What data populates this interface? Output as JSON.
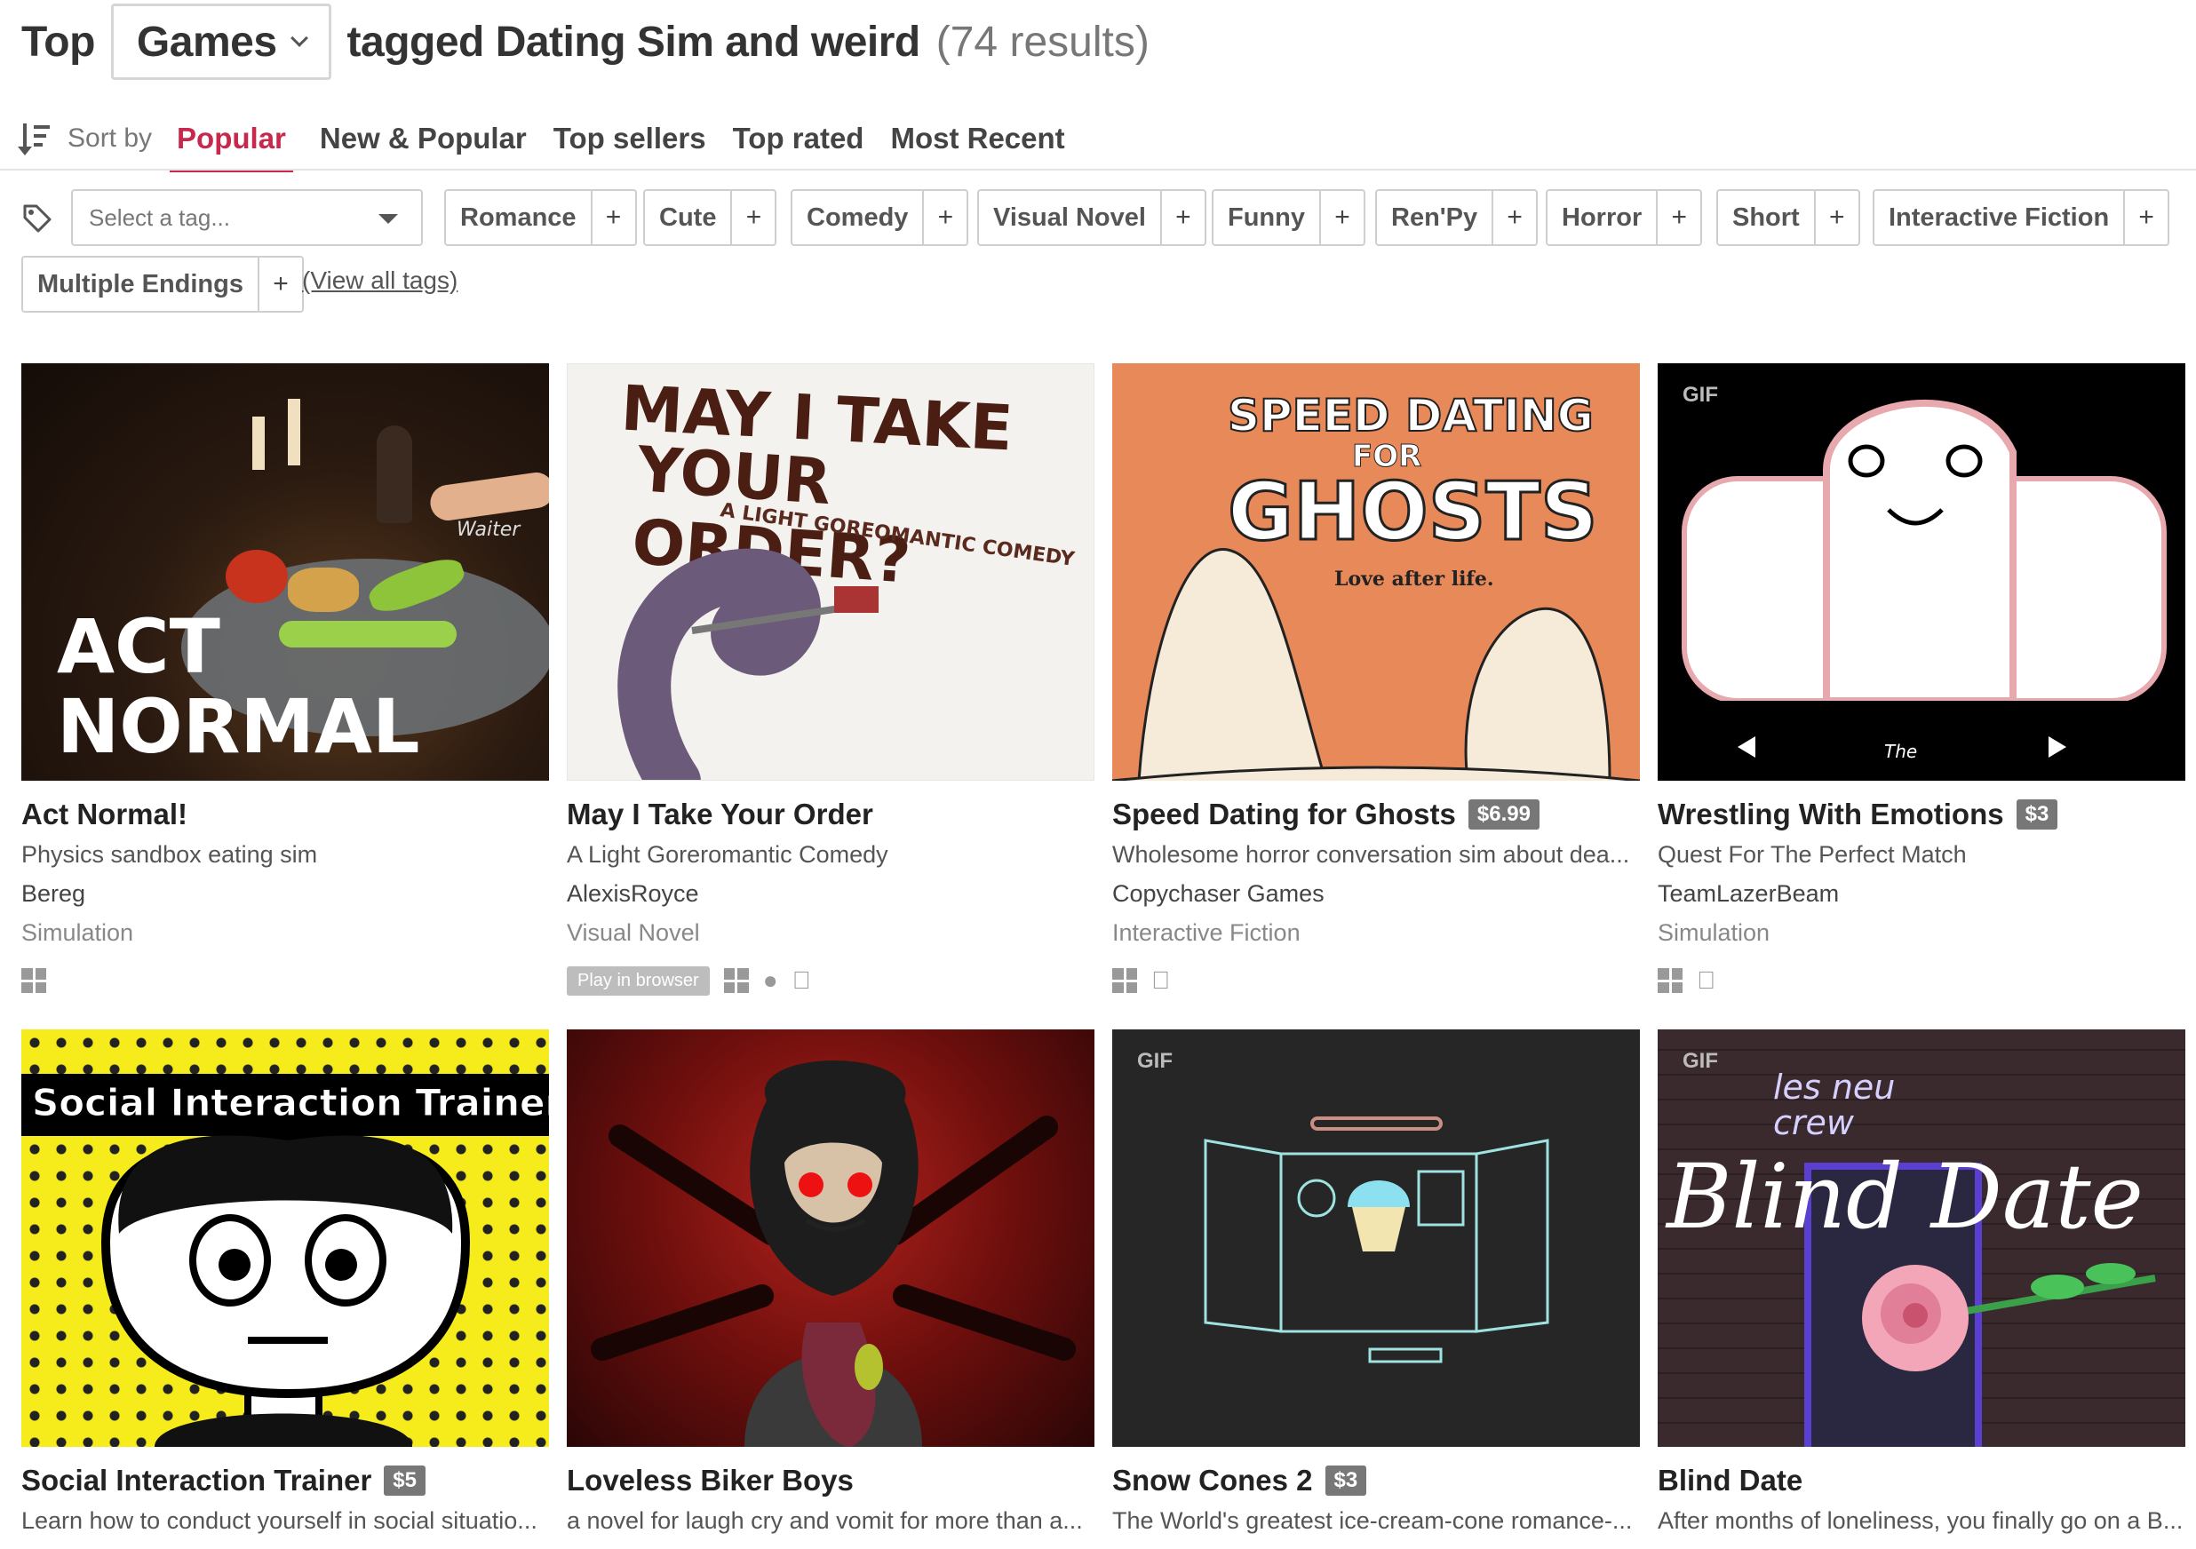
{
  "header": {
    "top_word": "Top",
    "category": "Games",
    "tagged_text": "tagged Dating Sim and weird",
    "result_count": "(74 results)"
  },
  "sort": {
    "label": "Sort by",
    "tabs": [
      "Popular",
      "New & Popular",
      "Top sellers",
      "Top rated",
      "Most Recent"
    ],
    "active": "Popular"
  },
  "tags": {
    "select_placeholder": "Select a tag...",
    "chips": [
      "Romance",
      "Cute",
      "Comedy",
      "Visual Novel",
      "Funny",
      "Ren'Py",
      "Horror",
      "Short",
      "Interactive Fiction",
      "Multiple Endings"
    ],
    "view_all": "(View all tags)"
  },
  "games": [
    {
      "title": "Act Normal!",
      "price": "",
      "description": "Physics sandbox eating sim",
      "author": "Bereg",
      "genre": "Simulation",
      "platforms": [
        "windows-icon"
      ],
      "play_in_browser": "",
      "gif": false,
      "art_text": [
        "ACT",
        "NORMAL",
        "Waiter"
      ]
    },
    {
      "title": "May I Take Your Order",
      "price": "",
      "description": "A Light Goreromantic Comedy",
      "author": "AlexisRoyce",
      "genre": "Visual Novel",
      "platforms": [
        "windows-icon",
        "linux-icon",
        "apple-icon"
      ],
      "play_in_browser": "Play in browser",
      "gif": false,
      "art_text": [
        "MAY I TAKE",
        "YOUR ORDER?",
        "A LIGHT GOREOMANTIC COMEDY"
      ]
    },
    {
      "title": "Speed Dating for Ghosts",
      "price": "$6.99",
      "description": "Wholesome horror conversation sim about dea...",
      "author": "Copychaser Games",
      "genre": "Interactive Fiction",
      "platforms": [
        "windows-icon",
        "apple-icon"
      ],
      "play_in_browser": "",
      "gif": false,
      "art_text": [
        "SPEED DATING",
        "FOR",
        "GHOSTS",
        "Love after life."
      ]
    },
    {
      "title": "Wrestling With Emotions",
      "price": "$3",
      "description": "Quest For The Perfect Match",
      "author": "TeamLazerBeam",
      "genre": "Simulation",
      "platforms": [
        "windows-icon",
        "apple-icon"
      ],
      "play_in_browser": "",
      "gif": true,
      "gif_label": "GIF",
      "art_text": [
        "The"
      ]
    },
    {
      "title": "Social Interaction Trainer",
      "price": "$5",
      "description": "Learn how to conduct yourself in social situatio...",
      "gif": false,
      "art_text": [
        "Social Interaction Trainer"
      ]
    },
    {
      "title": "Loveless Biker Boys",
      "price": "",
      "description": "a novel for laugh cry and vomit for more than a...",
      "gif": false,
      "art_text": []
    },
    {
      "title": "Snow Cones 2",
      "price": "$3",
      "description": "The World's greatest ice-cream-cone romance-...",
      "gif": true,
      "gif_label": "GIF",
      "art_text": []
    },
    {
      "title": "Blind Date",
      "price": "",
      "description": "After months of loneliness, you finally go on a B...",
      "gif": true,
      "gif_label": "GIF",
      "art_text": [
        "les neu crew",
        "Blind Date"
      ]
    }
  ],
  "colors": {
    "accent": "#c8284d",
    "price_badge": "#777777"
  }
}
